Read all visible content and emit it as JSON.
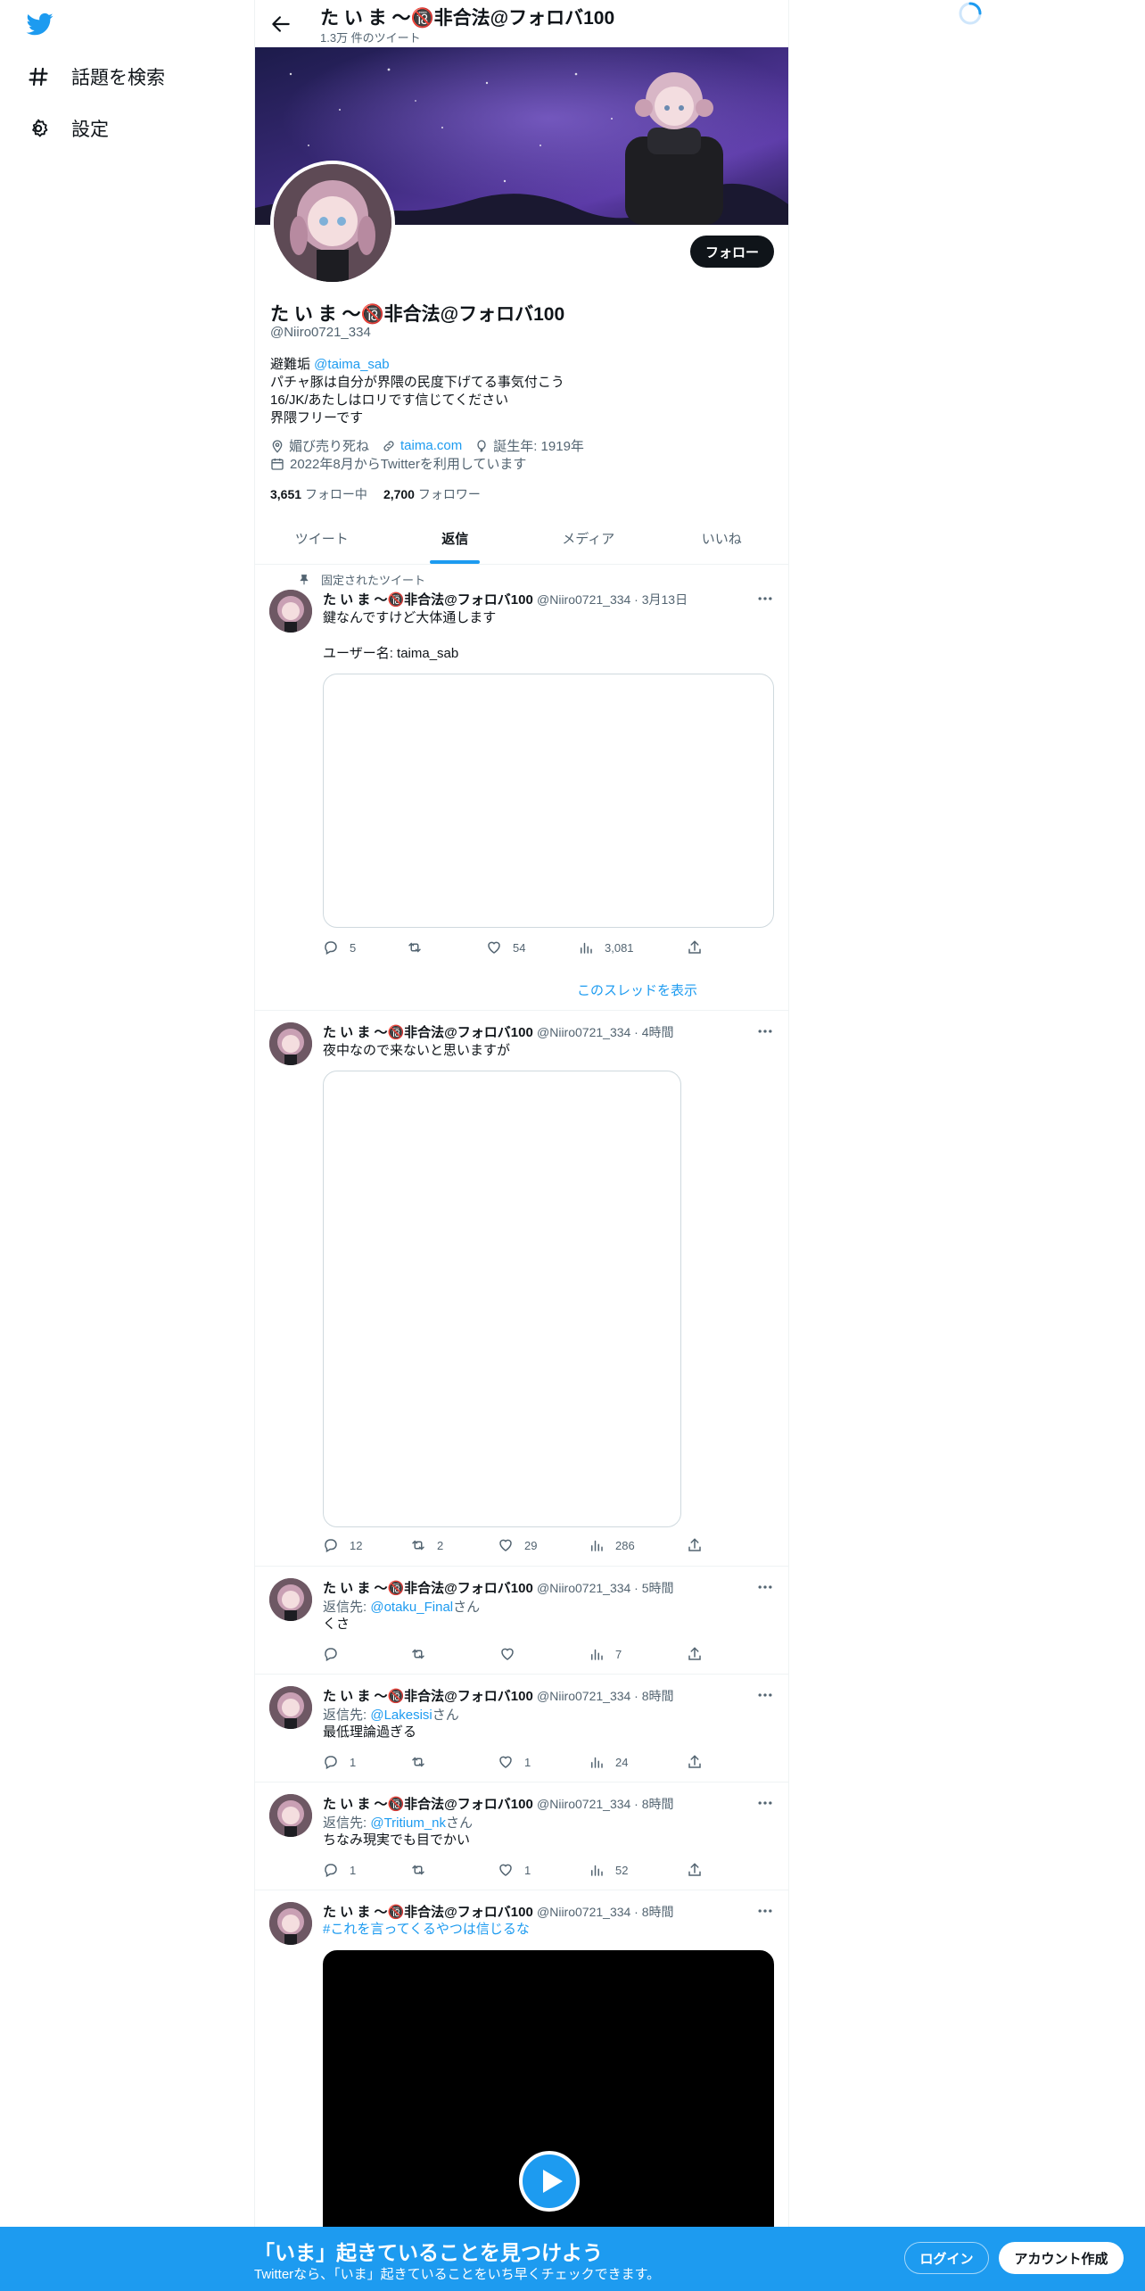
{
  "nav": {
    "explore_label": "話題を検索",
    "settings_label": "設定"
  },
  "header": {
    "name": "た い ま 〜🔞非合法@フォロバ100",
    "tweet_count": "1.3万 件のツイート"
  },
  "profile": {
    "name": "た い ま 〜🔞非合法@フォロバ100",
    "handle": "@Niiro0721_334",
    "follow_label": "フォロー",
    "bio": {
      "line1_prefix": "避難垢 ",
      "line1_link": "@taima_sab",
      "line2": "パチャ豚は自分が界隈の民度下げてる事気付こう",
      "line3": "16/JK/あたしはロリです信じてください",
      "line4": "界隈フリーです"
    },
    "location": "媚び売り死ね",
    "website": "taima.com",
    "birthday": "誕生年: 1919年",
    "joined": "2022年8月からTwitterを利用しています",
    "following_count": "3,651",
    "following_label": "フォロー中",
    "followers_count": "2,700",
    "followers_label": "フォロワー"
  },
  "tabs": [
    "ツイート",
    "返信",
    "メディア",
    "いいね"
  ],
  "pinned_label": "固定されたツイート",
  "show_thread": "このスレッドを表示",
  "tweets": [
    {
      "name": "た い ま 〜🔞非合法@フォロバ100",
      "meta": "@Niiro0721_334 · 3月13日",
      "text1": "鍵なんですけど大体通します",
      "text2": "ユーザー名: taima_sab",
      "replies": "5",
      "retweets": "",
      "likes": "54",
      "views": "3,081"
    },
    {
      "name": "た い ま 〜🔞非合法@フォロバ100",
      "meta": "@Niiro0721_334 · 4時間",
      "text1": "夜中なので来ないと思いますが",
      "replies": "12",
      "retweets": "2",
      "likes": "29",
      "views": "286"
    },
    {
      "name": "た い ま 〜🔞非合法@フォロバ100",
      "meta": "@Niiro0721_334 · 5時間",
      "reply_prefix": "返信先: ",
      "reply_to": "@otaku_Final",
      "reply_suffix": "さん",
      "text1": "くさ",
      "replies": "",
      "retweets": "",
      "likes": "",
      "views": "7"
    },
    {
      "name": "た い ま 〜🔞非合法@フォロバ100",
      "meta": "@Niiro0721_334 · 8時間",
      "reply_prefix": "返信先: ",
      "reply_to": "@Lakesisi",
      "reply_suffix": "さん",
      "text1": "最低理論過ぎる",
      "replies": "1",
      "retweets": "",
      "likes": "1",
      "views": "24"
    },
    {
      "name": "た い ま 〜🔞非合法@フォロバ100",
      "meta": "@Niiro0721_334 · 8時間",
      "reply_prefix": "返信先: ",
      "reply_to": "@Tritium_nk",
      "reply_suffix": "さん",
      "text1": "ちなみ現実でも目でかい",
      "replies": "1",
      "retweets": "",
      "likes": "1",
      "views": "52"
    },
    {
      "name": "た い ま 〜🔞非合法@フォロバ100",
      "meta": "@Niiro0721_334 · 8時間",
      "text1": "#これを言ってくるやつは信じるな"
    }
  ],
  "bottom": {
    "title": "「いま」起きていることを見つけよう",
    "subtitle": "Twitterなら、「いま」起きていることをいち早くチェックできます。",
    "login": "ログイン",
    "signup": "アカウント作成"
  },
  "colors": {
    "accent": "#1d9bf0",
    "text": "#0f1419",
    "secondary": "#536471"
  }
}
